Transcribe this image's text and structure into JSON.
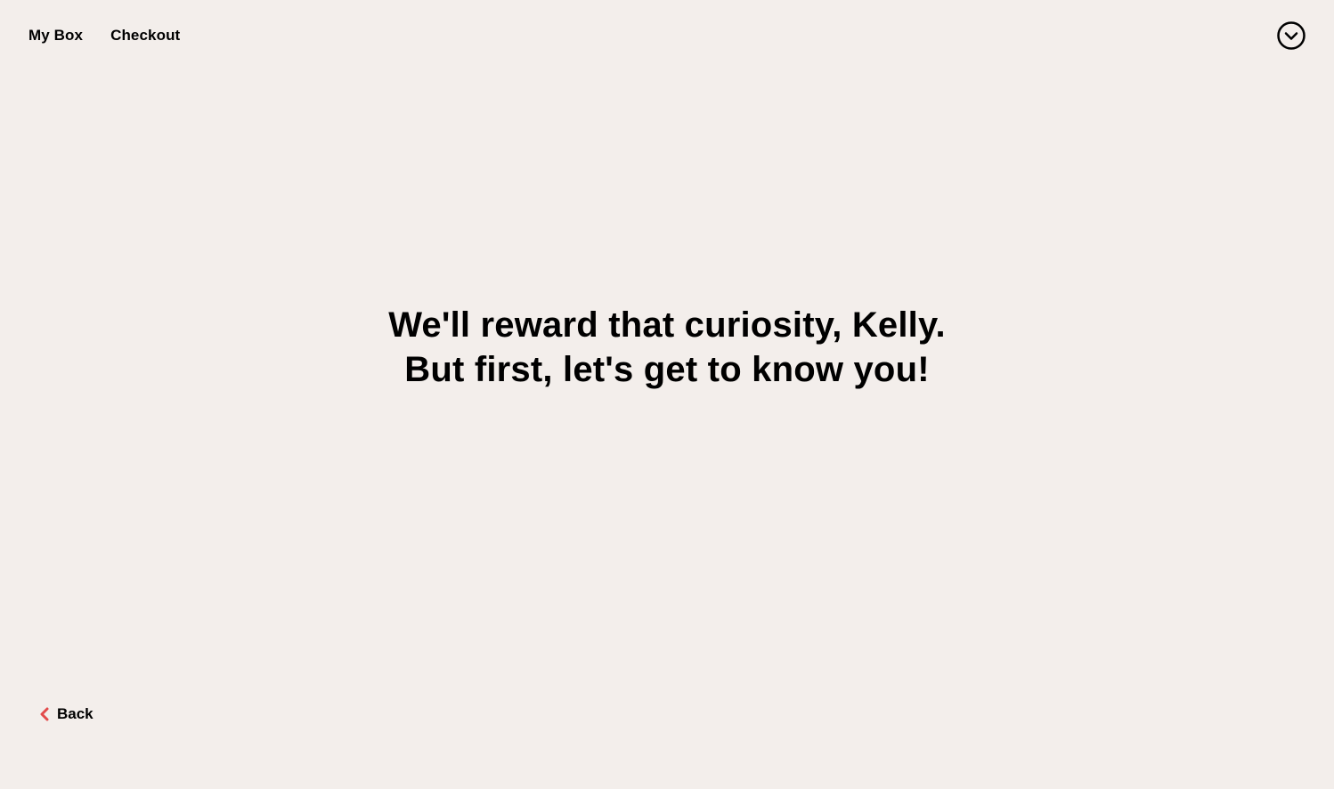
{
  "nav": {
    "my_box": "My Box",
    "checkout": "Checkout"
  },
  "menu": {
    "icon": "chevron-down-circle-icon"
  },
  "hero": {
    "line1": "We'll reward that curiosity, Kelly.",
    "line2": "But first, let's get to know you!"
  },
  "footer": {
    "back_label": "Back",
    "back_icon": "chevron-left-icon",
    "accent_color": "#e24a4a"
  },
  "colors": {
    "background": "#f3eeeb",
    "text": "#000000"
  }
}
